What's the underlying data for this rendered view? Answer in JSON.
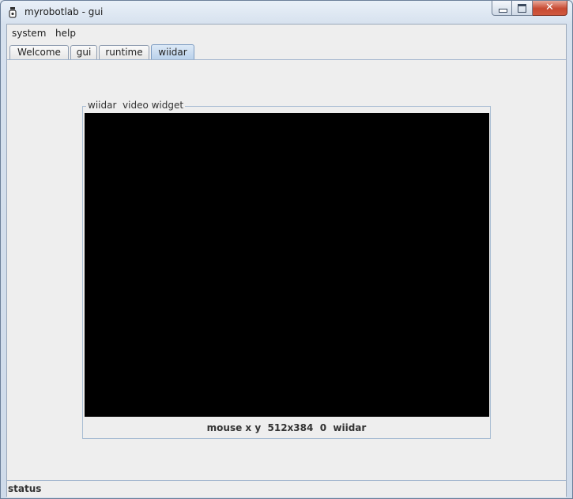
{
  "window": {
    "title": "myrobotlab - gui",
    "icon": "myrobotlab-app-icon",
    "controls": {
      "minimize": "minimize-icon",
      "maximize": "maximize-icon",
      "close_label": "✕"
    }
  },
  "menubar": {
    "items": [
      {
        "label": "system"
      },
      {
        "label": "help"
      }
    ]
  },
  "tabs": [
    {
      "label": "Welcome",
      "active": false
    },
    {
      "label": "gui",
      "active": false
    },
    {
      "label": "runtime",
      "active": false
    },
    {
      "label": "wiidar",
      "active": true
    }
  ],
  "video_widget": {
    "legend": "wiidar  video widget",
    "mouse_info": "mouse x y  512x384  0  wiidar",
    "background_color": "#000000"
  },
  "status": {
    "text": "status"
  }
}
